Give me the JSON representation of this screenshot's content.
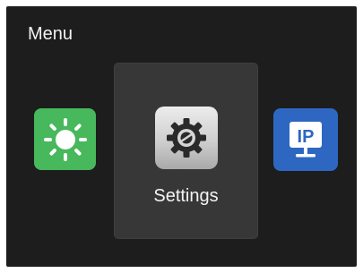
{
  "header": {
    "title": "Menu"
  },
  "apps": {
    "left": {
      "icon": "brightness-icon",
      "color": "#47b85b"
    },
    "selected": {
      "label": "Settings",
      "icon": "gear-icon",
      "color": "#cfcfcf"
    },
    "right": {
      "icon": "ip-monitor-icon",
      "badge_text": "IP",
      "color": "#2e67c2"
    }
  },
  "colors": {
    "background": "#1d1d1d",
    "card": "#373737",
    "text": "#f2f2f2"
  }
}
